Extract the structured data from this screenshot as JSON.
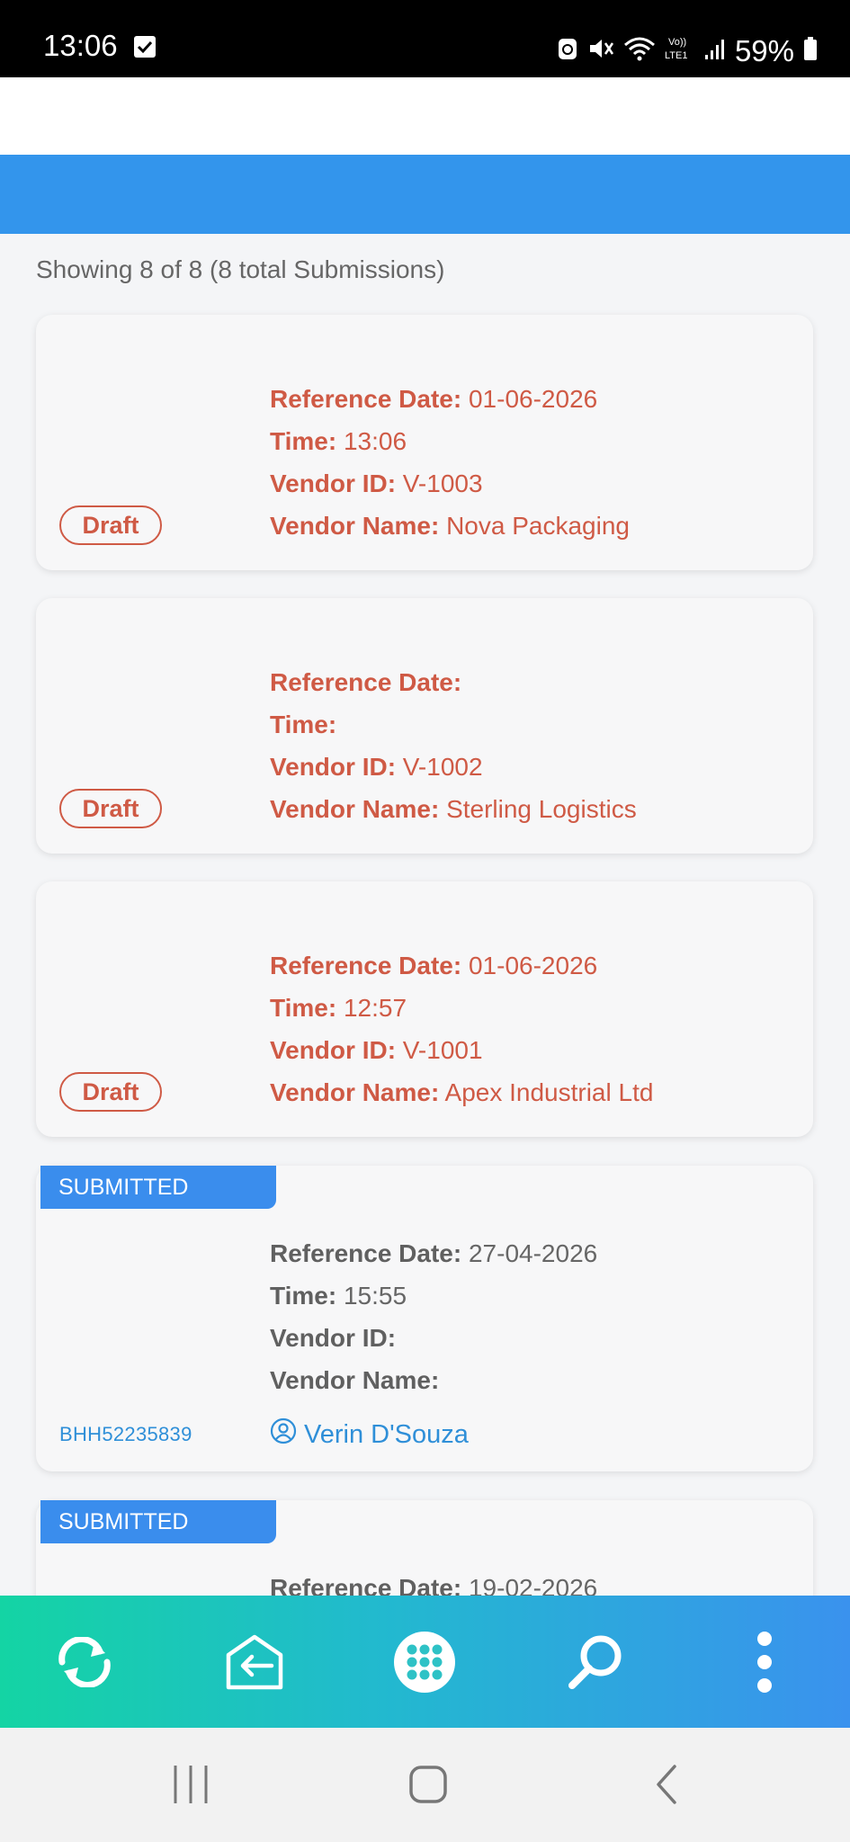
{
  "status_bar": {
    "time": "13:06",
    "battery": "59%",
    "icons": [
      "checkbox-notification-icon",
      "recycle-icon",
      "mute-icon",
      "wifi-icon",
      "volte-icon",
      "signal-icon",
      "battery-icon"
    ]
  },
  "list": {
    "summary": "Showing 8 of 8 (8 total Submissions)"
  },
  "labels": {
    "reference_date": "Reference Date:",
    "time": "Time:",
    "vendor_id": "Vendor ID:",
    "vendor_name": "Vendor Name:"
  },
  "cards": [
    {
      "status": "Draft",
      "reference_date": "01-06-2026",
      "time": "13:06",
      "vendor_id": "V-1003",
      "vendor_name": "Nova Packaging"
    },
    {
      "status": "Draft",
      "reference_date": "",
      "time": "",
      "vendor_id": "V-1002",
      "vendor_name": "Sterling Logistics"
    },
    {
      "status": "Draft",
      "reference_date": "01-06-2026",
      "time": "12:57",
      "vendor_id": "V-1001",
      "vendor_name": "Apex Industrial Ltd"
    },
    {
      "status": "SUBMITTED",
      "reference_date": "27-04-2026",
      "time": "15:55",
      "vendor_id": "",
      "vendor_name": "",
      "code": "BHH52235839",
      "user": "Verin D'Souza"
    },
    {
      "status": "SUBMITTED",
      "reference_date": "19-02-2026"
    }
  ],
  "toolbar": {
    "items": [
      "sync-icon",
      "exit-icon",
      "apps-grid-icon",
      "search-icon",
      "more-vertical-icon"
    ]
  },
  "nav": {
    "items": [
      "recent-apps-icon",
      "home-icon",
      "back-icon"
    ]
  },
  "colors": {
    "accent_blue": "#3395ec",
    "draft_red": "#cf5a45",
    "link_blue": "#2f8fd8",
    "toolbar_start": "#14d4a4",
    "toolbar_end": "#3a92ee"
  }
}
